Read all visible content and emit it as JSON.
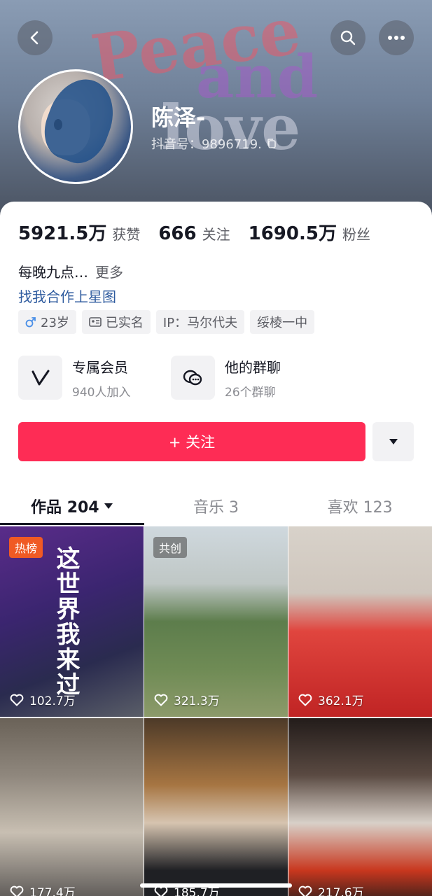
{
  "header": {
    "nickname": "陈泽-",
    "douyin_id": "抖音号：9896719.",
    "banner_words": [
      "Peace",
      "and",
      "love"
    ]
  },
  "stats": [
    {
      "value": "5921.5万",
      "label": "获赞"
    },
    {
      "value": "666",
      "label": "关注"
    },
    {
      "value": "1690.5万",
      "label": "粉丝"
    }
  ],
  "bio": {
    "text": "每晚九点…",
    "more": "更多",
    "link": "找我合作上星图"
  },
  "tags": {
    "age": "23岁",
    "verified": "已实名",
    "ip": "IP：马尔代夫",
    "school": "绥棱一中"
  },
  "features": {
    "member_title": "专属会员",
    "member_sub": "940人加入",
    "group_title": "他的群聊",
    "group_sub": "26个群聊"
  },
  "follow": {
    "label": "+ 关注"
  },
  "tabs": {
    "works": "作品 204",
    "music": "音乐 3",
    "likes": "喜欢 123"
  },
  "videos": [
    {
      "badge": "热榜",
      "title": "这世界我来过",
      "likes": "102.7万"
    },
    {
      "badge": "共创",
      "likes": "321.3万"
    },
    {
      "likes": "362.1万"
    },
    {
      "likes": "177.4万"
    },
    {
      "likes": "185.7万"
    },
    {
      "likes": "217.6万"
    }
  ],
  "colors": {
    "accent": "#fe2c55",
    "link": "#2d5a9e",
    "hot_badge": "#f05a24"
  }
}
